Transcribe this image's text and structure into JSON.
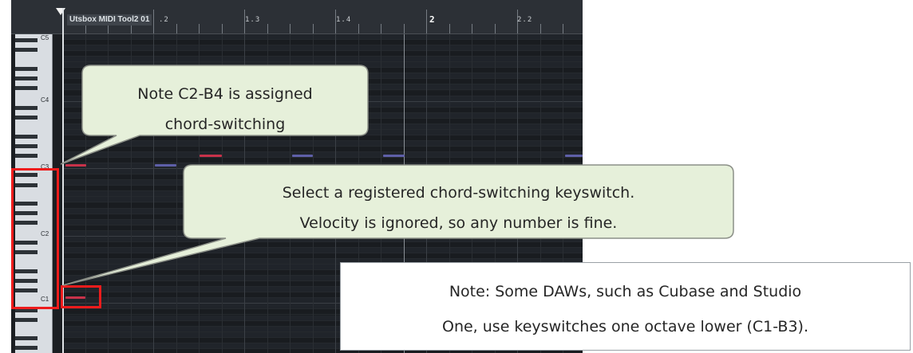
{
  "daw": {
    "clip_name": "Utsbox MIDI Tool2 01",
    "ruler": [
      {
        "label": ".2",
        "major": false
      },
      {
        "label": "1.3",
        "major": false
      },
      {
        "label": "1.4",
        "major": false
      },
      {
        "label": "2",
        "major": true
      },
      {
        "label": "2.2",
        "major": false
      }
    ],
    "key_labels": [
      "C5",
      "C4",
      "C3",
      "C2",
      "C1"
    ],
    "colors": {
      "note_red": "#c8324a",
      "note_blue": "#5e5fa8",
      "highlight": "#ee1c1c",
      "callout_fill": "#e6f0da",
      "callout_border": "#8c9088"
    }
  },
  "callouts": {
    "top": {
      "line1": "Note C2-B4 is assigned",
      "line2": "chord-switching"
    },
    "middle": {
      "line1": "Select a registered chord-switching keyswitch.",
      "line2": "Velocity is ignored, so any number is fine."
    }
  },
  "note_box": {
    "line1": "Note: Some DAWs, such as Cubase and Studio",
    "line2": "One, use keyswitches one octave lower (C1-B3)."
  }
}
